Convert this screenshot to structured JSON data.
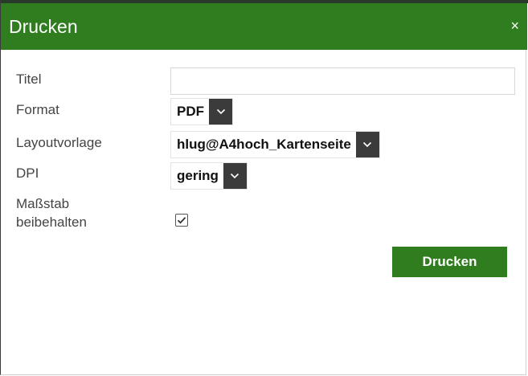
{
  "dialog": {
    "title": "Drucken",
    "close_glyph": "×",
    "accent_color": "#2f7d1f"
  },
  "fields": {
    "title_label": "Titel",
    "title_value": "",
    "format_label": "Format",
    "format_value": "PDF",
    "layout_label": "Layoutvorlage",
    "layout_value": "hlug@A4hoch_Kartenseite",
    "dpi_label": "DPI",
    "dpi_value": "gering",
    "scale_label_line1": "Maßstab",
    "scale_label_line2": "beibehalten",
    "scale_checked": true
  },
  "actions": {
    "print_label": "Drucken"
  },
  "icons": {
    "close": "close-icon",
    "dropdown": "chevron-down-icon",
    "check": "checkmark-icon"
  }
}
